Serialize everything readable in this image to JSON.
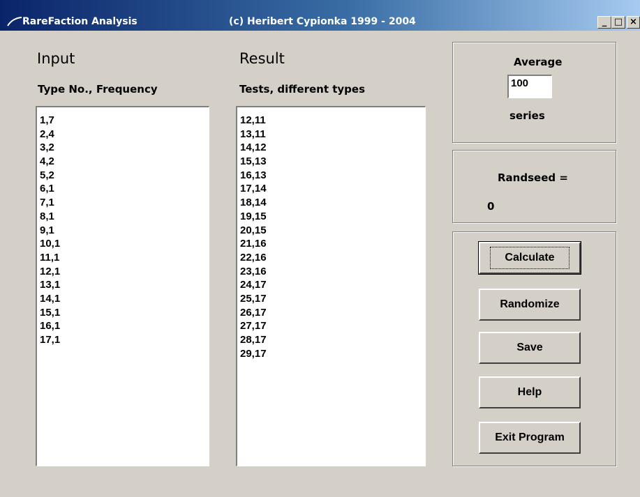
{
  "window": {
    "title": "RareFaction Analysis",
    "copyright": "(c) Heribert Cypionka 1999 - 2004",
    "minimize": "_",
    "maximize": "□",
    "close": "×"
  },
  "input": {
    "heading": "Input",
    "subheading": "Type No., Frequency",
    "items": [
      "1,7",
      "2,4",
      "3,2",
      "4,2",
      "5,2",
      "6,1",
      "7,1",
      "8,1",
      "9,1",
      "10,1",
      "11,1",
      "12,1",
      "13,1",
      "14,1",
      "15,1",
      "16,1",
      "17,1"
    ]
  },
  "result": {
    "heading": "Result",
    "subheading": "Tests, different types",
    "items": [
      "12,11",
      "13,11",
      "14,12",
      "15,13",
      "16,13",
      "17,14",
      "18,14",
      "19,15",
      "20,15",
      "21,16",
      "22,16",
      "23,16",
      "24,17",
      "25,17",
      "26,17",
      "27,17",
      "28,17",
      "29,17"
    ]
  },
  "average": {
    "label": "Average",
    "value": "100",
    "unit": "series"
  },
  "randseed": {
    "label": "Randseed =",
    "value": "0"
  },
  "buttons": {
    "calculate": "Calculate",
    "randomize": "Randomize",
    "save": "Save",
    "help": "Help",
    "exit": "Exit Program"
  }
}
